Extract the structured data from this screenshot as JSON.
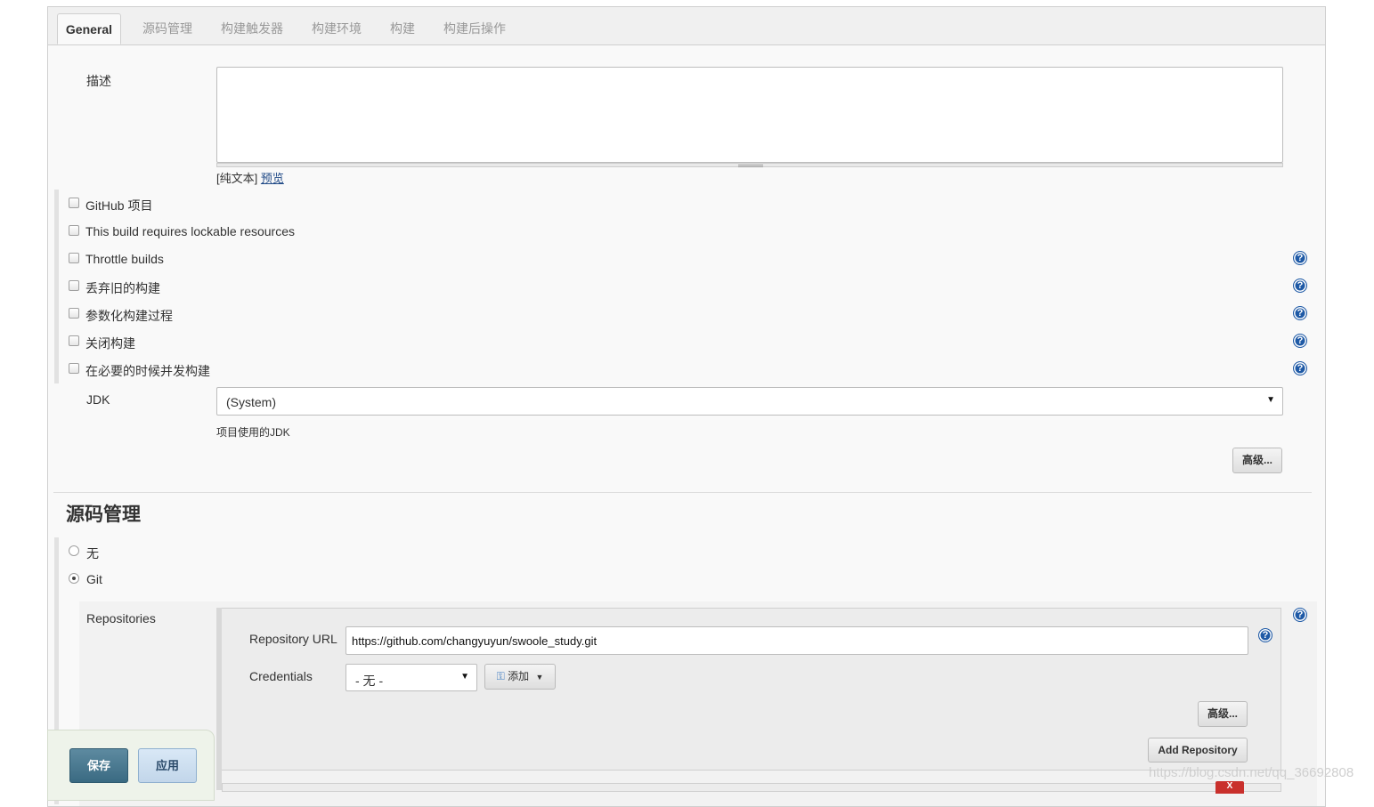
{
  "tabs": [
    "General",
    "源码管理",
    "构建触发器",
    "构建环境",
    "构建",
    "构建后操作"
  ],
  "general": {
    "description_label": "描述",
    "format_plain": "[纯文本]",
    "format_preview": "预览",
    "options": [
      {
        "label": "GitHub 项目",
        "checked": false,
        "help": false
      },
      {
        "label": "This build requires lockable resources",
        "checked": false,
        "help": false
      },
      {
        "label": "Throttle builds",
        "checked": false,
        "help": true
      },
      {
        "label": "丢弃旧的构建",
        "checked": false,
        "help": true
      },
      {
        "label": "参数化构建过程",
        "checked": false,
        "help": true
      },
      {
        "label": "关闭构建",
        "checked": false,
        "help": true
      },
      {
        "label": "在必要的时候并发构建",
        "checked": false,
        "help": true
      }
    ],
    "jdk_label": "JDK",
    "jdk_value": "(System)",
    "jdk_hint": "项目使用的JDK",
    "advanced_button": "高级..."
  },
  "scm": {
    "title": "源码管理",
    "none_label": "无",
    "git_label": "Git",
    "repositories_label": "Repositories",
    "repo_url_label": "Repository URL",
    "repo_url_value": "https://github.com/changyuyun/swoole_study.git",
    "credentials_label": "Credentials",
    "credentials_value": "- 无 -",
    "add_button": "添加",
    "advanced_button": "高级...",
    "add_repository_button": "Add Repository",
    "delete_button": "X"
  },
  "footer": {
    "save_button": "保存",
    "apply_button": "应用"
  },
  "watermark": "https://blog.csdn.net/qq_36692808",
  "colors": {
    "save_bg": "#3a6a82",
    "apply_bg": "#c2d6ea",
    "help_icon": "#1f5aa6",
    "delete_bg": "#c9302c"
  }
}
